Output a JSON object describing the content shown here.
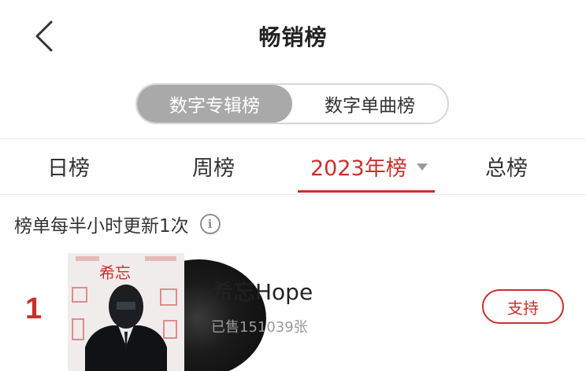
{
  "header": {
    "title": "畅销榜",
    "back_icon": "chevron-left-icon"
  },
  "segments": {
    "items": [
      {
        "label": "数字专辑榜",
        "active": true
      },
      {
        "label": "数字单曲榜",
        "active": false
      }
    ]
  },
  "tabs": {
    "items": [
      {
        "label": "日榜",
        "active": false
      },
      {
        "label": "周榜",
        "active": false
      },
      {
        "label": "2023年榜",
        "active": true,
        "has_dropdown": true
      },
      {
        "label": "总榜",
        "active": false
      }
    ]
  },
  "notice": {
    "text": "榜单每半小时更新1次",
    "info_icon_glyph": "i"
  },
  "list": {
    "items": [
      {
        "rank": "1",
        "cover_text": "希忘",
        "title": "希忘Hope",
        "sales": "已售151039张",
        "support_label": "支持"
      }
    ]
  },
  "colors": {
    "accent": "#c9302c",
    "segment_active_bg": "#a9a9a9",
    "muted_text": "#999999"
  }
}
